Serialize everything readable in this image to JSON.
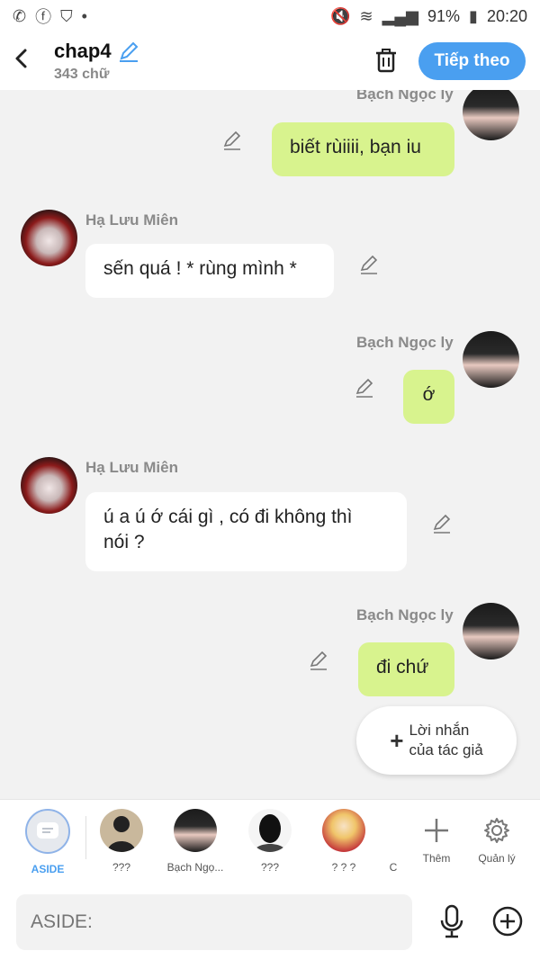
{
  "status_bar": {
    "battery": "91%",
    "time": "20:20"
  },
  "header": {
    "title": "chap4",
    "subtitle": "343 chữ",
    "next_label": "Tiếp theo"
  },
  "messages": [
    {
      "side": "me",
      "name": "Bạch Ngọc ly",
      "text": "biết rùiiii, bạn iu"
    },
    {
      "side": "them",
      "name": "Hạ Lưu Miên",
      "text": "sến quá ! * rùng mình *"
    },
    {
      "side": "me",
      "name": "Bạch Ngọc ly",
      "text": "ớ"
    },
    {
      "side": "them",
      "name": "Hạ Lưu Miên",
      "text_line1": "ú a ú ớ cái gì , có đi không thì",
      "text_line2": "nói ?"
    },
    {
      "side": "me",
      "name": "Bạch Ngọc ly",
      "text": "đi chứ"
    }
  ],
  "author_note": {
    "line1": "Lời nhắn",
    "line2": "của tác giả"
  },
  "characters": [
    {
      "label": "ASIDE"
    },
    {
      "label": "???"
    },
    {
      "label": "Bạch Ngọ..."
    },
    {
      "label": "???"
    },
    {
      "label": "? ? ?"
    },
    {
      "label": "C"
    },
    {
      "label": "Thêm"
    },
    {
      "label": "Quản lý"
    }
  ],
  "input": {
    "placeholder": "ASIDE:"
  },
  "colors": {
    "accent": "#4a9ff0",
    "my_bubble": "#d8f38e",
    "aside_label": "#4a9ff0"
  }
}
